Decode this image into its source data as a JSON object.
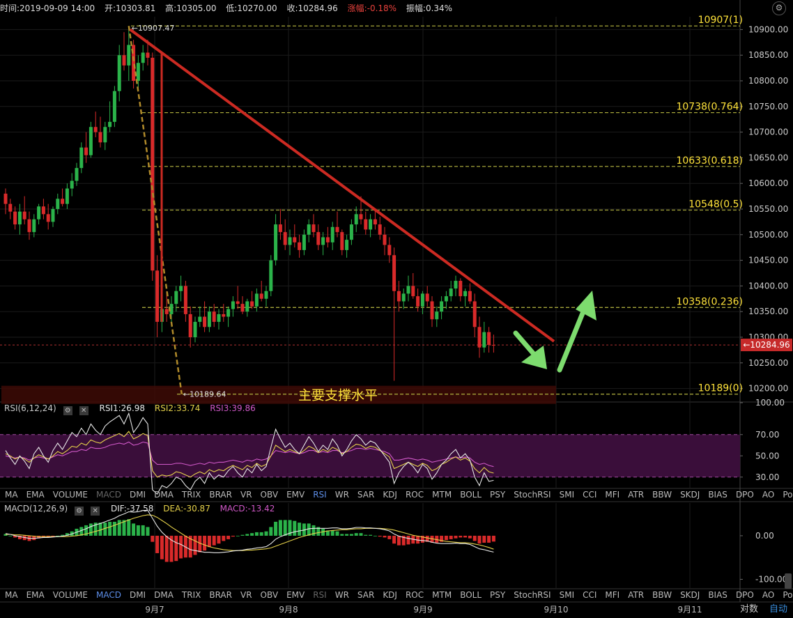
{
  "header": {
    "time": "时间:2019-09-09 14:00",
    "open": "开:10303.81",
    "high": "高:10305.00",
    "low": "低:10270.00",
    "close": "收:10284.96",
    "change": "涨幅:-0.18%",
    "amplitude": "振幅:0.34%",
    "settings_icon": "gear-icon"
  },
  "colors": {
    "up": "#2bb34a",
    "down": "#d92a2a",
    "fib_line": "#a6a63a",
    "fib_label": "#ffe33a",
    "trendline": "#cc2a22",
    "arrow": "#7ddc6e",
    "rsi_band": "#3a0e3a",
    "price_tag": "#c62a2a"
  },
  "chart_data": {
    "type": "candlestick",
    "ylim": [
      10175,
      10925
    ],
    "price_ticks": [
      "10900.00",
      "10850.00",
      "10800.00",
      "10750.00",
      "10700.00",
      "10650.00",
      "10600.00",
      "10550.00",
      "10500.00",
      "10450.00",
      "10400.00",
      "10350.00",
      "10300.00",
      "10250.00",
      "10200.00"
    ],
    "price_tick_values": [
      10900,
      10850,
      10800,
      10750,
      10700,
      10650,
      10600,
      10550,
      10500,
      10450,
      10400,
      10350,
      10300,
      10250,
      10200
    ],
    "x_labels": [
      "9月7",
      "9月8",
      "9月9",
      "9月10",
      "9月11"
    ],
    "last_price": "10284.96",
    "last_price_value": 10284.96,
    "candles_ohlc": [
      [
        10580,
        10590,
        10540,
        10560
      ],
      [
        10560,
        10570,
        10530,
        10545
      ],
      [
        10545,
        10555,
        10510,
        10520
      ],
      [
        10520,
        10560,
        10500,
        10545
      ],
      [
        10545,
        10575,
        10520,
        10530
      ],
      [
        10530,
        10545,
        10490,
        10505
      ],
      [
        10505,
        10540,
        10495,
        10530
      ],
      [
        10530,
        10560,
        10520,
        10555
      ],
      [
        10555,
        10570,
        10530,
        10540
      ],
      [
        10540,
        10560,
        10510,
        10525
      ],
      [
        10525,
        10555,
        10515,
        10550
      ],
      [
        10550,
        10580,
        10540,
        10570
      ],
      [
        10570,
        10590,
        10555,
        10560
      ],
      [
        10560,
        10600,
        10550,
        10590
      ],
      [
        10590,
        10620,
        10575,
        10605
      ],
      [
        10605,
        10640,
        10595,
        10630
      ],
      [
        10630,
        10680,
        10620,
        10670
      ],
      [
        10670,
        10700,
        10640,
        10655
      ],
      [
        10655,
        10720,
        10650,
        10710
      ],
      [
        10710,
        10740,
        10690,
        10700
      ],
      [
        10700,
        10730,
        10670,
        10680
      ],
      [
        10680,
        10720,
        10665,
        10710
      ],
      [
        10710,
        10760,
        10700,
        10720
      ],
      [
        10720,
        10790,
        10710,
        10780
      ],
      [
        10780,
        10870,
        10760,
        10850
      ],
      [
        10850,
        10895,
        10820,
        10830
      ],
      [
        10830,
        10907,
        10800,
        10870
      ],
      [
        10870,
        10880,
        10785,
        10800
      ],
      [
        10800,
        10850,
        10780,
        10835
      ],
      [
        10835,
        10870,
        10820,
        10855
      ],
      [
        10855,
        10880,
        10830,
        10845
      ],
      [
        10845,
        10855,
        10410,
        10430
      ],
      [
        10430,
        10460,
        10300,
        10330
      ],
      [
        10330,
        10370,
        10310,
        10355
      ],
      [
        10355,
        10390,
        10330,
        10345
      ],
      [
        10345,
        10380,
        10320,
        10365
      ],
      [
        10365,
        10400,
        10350,
        10390
      ],
      [
        10390,
        10420,
        10370,
        10400
      ],
      [
        10400,
        10410,
        10330,
        10345
      ],
      [
        10345,
        10360,
        10280,
        10300
      ],
      [
        10300,
        10340,
        10290,
        10330
      ],
      [
        10330,
        10360,
        10320,
        10340
      ],
      [
        10340,
        10370,
        10310,
        10320
      ],
      [
        10320,
        10360,
        10310,
        10350
      ],
      [
        10350,
        10365,
        10320,
        10330
      ],
      [
        10330,
        10355,
        10315,
        10345
      ],
      [
        10345,
        10365,
        10330,
        10340
      ],
      [
        10340,
        10360,
        10320,
        10355
      ],
      [
        10355,
        10380,
        10340,
        10370
      ],
      [
        10370,
        10400,
        10355,
        10365
      ],
      [
        10365,
        10380,
        10345,
        10350
      ],
      [
        10350,
        10375,
        10340,
        10370
      ],
      [
        10370,
        10390,
        10355,
        10360
      ],
      [
        10360,
        10395,
        10350,
        10385
      ],
      [
        10385,
        10410,
        10370,
        10375
      ],
      [
        10375,
        10400,
        10360,
        10390
      ],
      [
        10390,
        10460,
        10380,
        10450
      ],
      [
        10450,
        10540,
        10440,
        10520
      ],
      [
        10520,
        10550,
        10490,
        10505
      ],
      [
        10505,
        10530,
        10470,
        10480
      ],
      [
        10480,
        10510,
        10460,
        10495
      ],
      [
        10495,
        10520,
        10475,
        10485
      ],
      [
        10485,
        10500,
        10455,
        10470
      ],
      [
        10470,
        10510,
        10460,
        10500
      ],
      [
        10500,
        10530,
        10485,
        10520
      ],
      [
        10520,
        10540,
        10495,
        10505
      ],
      [
        10505,
        10520,
        10470,
        10480
      ],
      [
        10480,
        10505,
        10460,
        10495
      ],
      [
        10495,
        10515,
        10475,
        10485
      ],
      [
        10485,
        10525,
        10470,
        10515
      ],
      [
        10515,
        10545,
        10495,
        10505
      ],
      [
        10505,
        10510,
        10460,
        10470
      ],
      [
        10470,
        10500,
        10455,
        10490
      ],
      [
        10490,
        10530,
        10480,
        10520
      ],
      [
        10520,
        10555,
        10505,
        10540
      ],
      [
        10540,
        10575,
        10520,
        10530
      ],
      [
        10530,
        10545,
        10500,
        10510
      ],
      [
        10510,
        10540,
        10495,
        10530
      ],
      [
        10530,
        10550,
        10510,
        10520
      ],
      [
        10520,
        10535,
        10490,
        10500
      ],
      [
        10500,
        10515,
        10460,
        10480
      ],
      [
        10480,
        10495,
        10445,
        10460
      ],
      [
        10460,
        10475,
        10215,
        10390
      ],
      [
        10390,
        10410,
        10350,
        10370
      ],
      [
        10370,
        10395,
        10355,
        10385
      ],
      [
        10385,
        10420,
        10370,
        10400
      ],
      [
        10400,
        10425,
        10375,
        10380
      ],
      [
        10380,
        10395,
        10350,
        10360
      ],
      [
        10360,
        10390,
        10345,
        10385
      ],
      [
        10385,
        10400,
        10360,
        10370
      ],
      [
        10370,
        10380,
        10320,
        10335
      ],
      [
        10335,
        10360,
        10320,
        10350
      ],
      [
        10350,
        10380,
        10335,
        10370
      ],
      [
        10370,
        10390,
        10355,
        10380
      ],
      [
        10380,
        10410,
        10370,
        10395
      ],
      [
        10395,
        10420,
        10380,
        10410
      ],
      [
        10410,
        10415,
        10370,
        10380
      ],
      [
        10380,
        10395,
        10360,
        10390
      ],
      [
        10390,
        10405,
        10365,
        10370
      ],
      [
        10370,
        10385,
        10300,
        10320
      ],
      [
        10320,
        10340,
        10260,
        10280
      ],
      [
        10280,
        10330,
        10270,
        10310
      ],
      [
        10310,
        10320,
        10270,
        10285
      ],
      [
        10285,
        10305,
        10270,
        10284.96
      ]
    ],
    "fib_levels": [
      {
        "value": 10907,
        "label": "10907(1)"
      },
      {
        "value": 10738,
        "label": "10738(0.764)"
      },
      {
        "value": 10633,
        "label": "10633(0.618)"
      },
      {
        "value": 10548,
        "label": "10548(0.5)"
      },
      {
        "value": 10358,
        "label": "10358(0.236)"
      },
      {
        "value": 10189,
        "label": "10189(0)"
      }
    ],
    "high_annotation": "←10907.47",
    "low_annotation": "←10189.64",
    "support_label": "主要支撑水平",
    "rsi": {
      "title": "RSI(6,12,24)",
      "rsi1_label": "RSI1:26.98",
      "rsi2_label": "RSI2:33.74",
      "rsi3_label": "RSI3:39.86",
      "ylim": [
        20,
        100
      ],
      "ticks": [
        "100.00",
        "70.00",
        "50.00",
        "30.00"
      ],
      "tick_values": [
        100,
        70,
        50,
        30
      ],
      "band": [
        30,
        70
      ],
      "rsi1": [
        55,
        48,
        42,
        50,
        45,
        38,
        52,
        58,
        50,
        44,
        55,
        62,
        56,
        64,
        72,
        68,
        76,
        70,
        80,
        74,
        70,
        78,
        82,
        85,
        88,
        80,
        90,
        72,
        78,
        86,
        80,
        18,
        14,
        22,
        20,
        24,
        30,
        28,
        22,
        18,
        26,
        30,
        24,
        34,
        28,
        32,
        30,
        36,
        40,
        34,
        30,
        38,
        34,
        42,
        36,
        40,
        58,
        75,
        66,
        58,
        62,
        56,
        52,
        60,
        68,
        62,
        54,
        60,
        56,
        66,
        60,
        50,
        56,
        64,
        70,
        66,
        60,
        64,
        62,
        56,
        50,
        44,
        24,
        34,
        40,
        44,
        40,
        34,
        42,
        38,
        28,
        34,
        42,
        46,
        52,
        56,
        48,
        52,
        46,
        30,
        22,
        34,
        26,
        26.98
      ],
      "rsi2": [
        52,
        50,
        47,
        49,
        47,
        44,
        48,
        51,
        49,
        47,
        50,
        54,
        52,
        55,
        59,
        58,
        62,
        60,
        65,
        63,
        62,
        65,
        67,
        69,
        71,
        68,
        73,
        66,
        68,
        71,
        69,
        36,
        30,
        32,
        31,
        32,
        35,
        34,
        32,
        30,
        33,
        35,
        33,
        37,
        35,
        37,
        36,
        39,
        41,
        39,
        37,
        41,
        39,
        43,
        40,
        42,
        50,
        60,
        57,
        54,
        56,
        54,
        52,
        55,
        59,
        57,
        53,
        56,
        54,
        58,
        56,
        52,
        54,
        58,
        61,
        60,
        57,
        59,
        58,
        55,
        52,
        49,
        38,
        40,
        42,
        44,
        42,
        40,
        43,
        41,
        36,
        38,
        42,
        44,
        47,
        49,
        46,
        48,
        45,
        38,
        34,
        39,
        35,
        33.74
      ],
      "rsi3": [
        50,
        49,
        48,
        49,
        48,
        46,
        48,
        49,
        48,
        47,
        49,
        51,
        50,
        52,
        54,
        54,
        56,
        55,
        58,
        57,
        57,
        58,
        60,
        61,
        62,
        61,
        63,
        60,
        61,
        63,
        62,
        46,
        42,
        42,
        42,
        42,
        43,
        43,
        42,
        41,
        42,
        43,
        42,
        44,
        43,
        44,
        44,
        45,
        46,
        45,
        44,
        46,
        45,
        47,
        46,
        47,
        50,
        55,
        54,
        53,
        54,
        53,
        52,
        53,
        55,
        55,
        53,
        54,
        53,
        55,
        55,
        53,
        54,
        55,
        57,
        57,
        56,
        57,
        56,
        55,
        54,
        52,
        46,
        46,
        47,
        48,
        47,
        46,
        47,
        46,
        44,
        45,
        46,
        47,
        48,
        49,
        48,
        49,
        48,
        44,
        42,
        43,
        41,
        39.86
      ]
    },
    "macd": {
      "title": "MACD(12,26,9)",
      "dif_label": "DIF:-37.58",
      "dea_label": "DEA:-30.87",
      "macd_label": "MACD:-13.42",
      "ylim": [
        -120,
        75
      ],
      "ticks": [
        "0.00",
        "-100.00"
      ],
      "tick_values": [
        0,
        -100
      ],
      "dif": [
        5,
        3,
        0,
        -2,
        -4,
        -6,
        -6,
        -5,
        -4,
        -4,
        -3,
        -2,
        -1,
        1,
        4,
        8,
        12,
        16,
        21,
        25,
        28,
        32,
        36,
        40,
        46,
        50,
        55,
        54,
        55,
        58,
        58,
        40,
        22,
        8,
        -2,
        -10,
        -16,
        -20,
        -26,
        -32,
        -34,
        -36,
        -38,
        -38,
        -39,
        -39,
        -38,
        -37,
        -35,
        -34,
        -33,
        -31,
        -30,
        -28,
        -27,
        -25,
        -18,
        -8,
        -2,
        2,
        6,
        9,
        11,
        13,
        16,
        17,
        17,
        17,
        17,
        18,
        18,
        16,
        16,
        17,
        19,
        19,
        18,
        18,
        17,
        16,
        14,
        11,
        4,
        -1,
        -4,
        -6,
        -8,
        -10,
        -11,
        -12,
        -15,
        -17,
        -18,
        -18,
        -18,
        -17,
        -18,
        -18,
        -20,
        -25,
        -30,
        -32,
        -35,
        -37.58
      ],
      "dea": [
        3,
        3,
        2,
        2,
        1,
        0,
        -1,
        -2,
        -2,
        -2,
        -2,
        -2,
        -2,
        -2,
        -1,
        0,
        2,
        4,
        7,
        10,
        13,
        17,
        20,
        24,
        28,
        32,
        36,
        40,
        43,
        46,
        48,
        47,
        42,
        35,
        28,
        20,
        13,
        6,
        -1,
        -7,
        -12,
        -17,
        -21,
        -25,
        -28,
        -30,
        -32,
        -33,
        -34,
        -34,
        -34,
        -33,
        -33,
        -32,
        -31,
        -30,
        -28,
        -24,
        -20,
        -16,
        -12,
        -8,
        -4,
        -1,
        2,
        5,
        7,
        9,
        11,
        12,
        13,
        14,
        14,
        15,
        16,
        16,
        17,
        17,
        17,
        17,
        16,
        15,
        13,
        10,
        7,
        4,
        1,
        -1,
        -3,
        -5,
        -7,
        -9,
        -11,
        -13,
        -14,
        -15,
        -16,
        -16,
        -17,
        -19,
        -21,
        -24,
        -27,
        -30.87
      ],
      "hist": [
        4,
        0,
        -4,
        -8,
        -10,
        -12,
        -10,
        -6,
        -4,
        -4,
        -2,
        0,
        2,
        6,
        10,
        16,
        20,
        24,
        28,
        30,
        30,
        30,
        32,
        32,
        36,
        36,
        38,
        28,
        24,
        24,
        20,
        -14,
        -40,
        -54,
        -60,
        -60,
        -58,
        -52,
        -50,
        -50,
        -44,
        -38,
        -34,
        -26,
        -22,
        -18,
        -12,
        -8,
        -2,
        0,
        2,
        4,
        6,
        8,
        8,
        10,
        20,
        32,
        36,
        36,
        36,
        34,
        30,
        28,
        28,
        24,
        20,
        16,
        12,
        12,
        10,
        4,
        4,
        4,
        6,
        6,
        2,
        2,
        0,
        -2,
        -4,
        -8,
        -18,
        -22,
        -22,
        -20,
        -18,
        -18,
        -16,
        -14,
        -16,
        -16,
        -14,
        -10,
        -8,
        -6,
        -4,
        -4,
        -6,
        -12,
        -18,
        -16,
        -16,
        -13.42
      ]
    }
  },
  "indicator_tabs": [
    "MA",
    "EMA",
    "VOLUME",
    "MACD",
    "DMI",
    "DMA",
    "TRIX",
    "BRAR",
    "VR",
    "OBV",
    "EMV",
    "RSI",
    "WR",
    "SAR",
    "KDJ",
    "ROC",
    "MTM",
    "BOLL",
    "PSY",
    "StochRSI",
    "SMI",
    "CCI",
    "MFI",
    "ATR",
    "BBW",
    "SKDJ",
    "BIAS",
    "DPO",
    "AO",
    "Position"
  ],
  "tabs_row1_active": "RSI",
  "tabs_row1_dim": "MACD",
  "tabs_row2_active": "MACD",
  "tabs_row2_dim": "RSI",
  "bottom": {
    "log_label": "对数",
    "auto_label": "自动"
  }
}
